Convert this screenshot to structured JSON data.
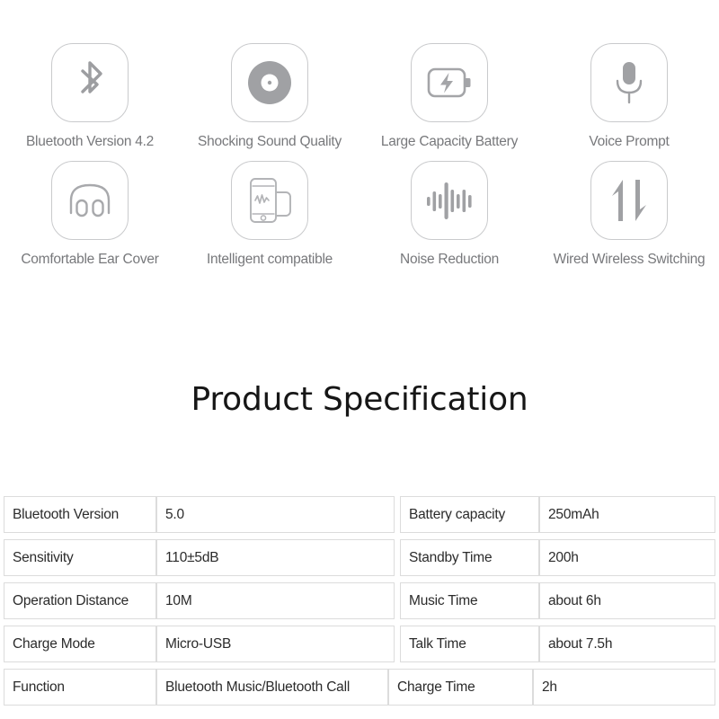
{
  "features": [
    [
      {
        "icon": "bluetooth-icon",
        "label": "Bluetooth Version 4.2"
      },
      {
        "icon": "disc-icon",
        "label": "Shocking Sound Quality"
      },
      {
        "icon": "battery-charging-icon",
        "label": "Large Capacity Battery"
      },
      {
        "icon": "microphone-icon",
        "label": "Voice Prompt"
      }
    ],
    [
      {
        "icon": "headphones-icon",
        "label": "Comfortable Ear Cover"
      },
      {
        "icon": "phone-device-icon",
        "label": "Intelligent compatible"
      },
      {
        "icon": "waveform-icon",
        "label": "Noise Reduction"
      },
      {
        "icon": "up-down-arrows-icon",
        "label": "Wired Wireless Switching"
      }
    ]
  ],
  "section": {
    "title": "Product Specification"
  },
  "spec_table": {
    "rows": [
      {
        "label_1": "Bluetooth Version",
        "value_1": "5.0",
        "label_2": "Battery capacity",
        "value_2": "250mAh"
      },
      {
        "label_1": "Sensitivity",
        "value_1": "110±5dB",
        "label_2": "Standby Time",
        "value_2": "200h"
      },
      {
        "label_1": "Operation Distance",
        "value_1": "10M",
        "label_2": "Music Time",
        "value_2": "about 6h"
      },
      {
        "label_1": "Charge Mode",
        "value_1": "Micro-USB",
        "label_2": "Talk Time",
        "value_2": "about 7.5h"
      },
      {
        "label_1": "Function",
        "value_1": "Bluetooth Music/Bluetooth Call",
        "label_2": "Charge Time",
        "value_2": "2h"
      }
    ]
  },
  "colors": {
    "icon_outline": "#c9cacc",
    "icon_fill": "#a0a1a4",
    "label_text": "#77787b",
    "title_text": "#161616",
    "table_border": "#dcdcdc",
    "table_text": "#2b2b2b",
    "background": "#ffffff"
  }
}
